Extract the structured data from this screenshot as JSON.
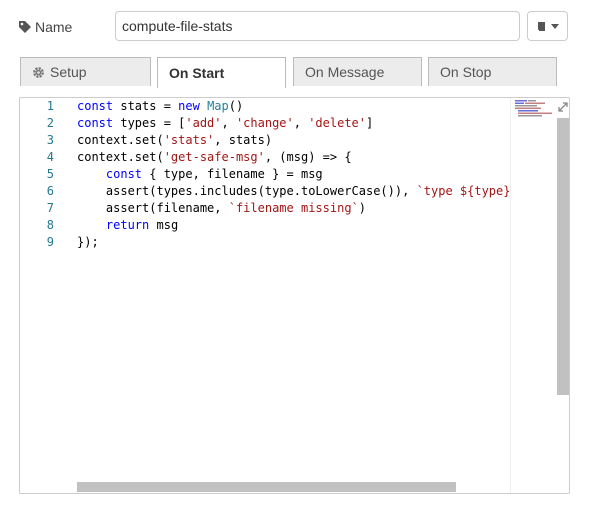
{
  "name_field": {
    "label": "Name",
    "value": "compute-file-stats"
  },
  "tabs": [
    {
      "label": "Setup",
      "icon": "gear-icon"
    },
    {
      "label": "On Start",
      "active": true
    },
    {
      "label": "On Message"
    },
    {
      "label": "On Stop"
    }
  ],
  "editor": {
    "line_numbers": [
      "1",
      "2",
      "3",
      "4",
      "5",
      "6",
      "7",
      "8",
      "9"
    ],
    "lines": [
      "const stats = new Map()",
      "const types = ['add', 'change', 'delete']",
      "context.set('stats', stats)",
      "context.set('get-safe-msg', (msg) => {",
      "    const { type, filename } = msg",
      "    assert(types.includes(type.toLowerCase()), `type ${type} forb",
      "    assert(filename, `filename missing`)",
      "    return msg",
      "});"
    ]
  },
  "colors": {
    "keyword": "#0000ff",
    "string": "#a31515",
    "type": "#267f99",
    "line_number": "#237893"
  }
}
